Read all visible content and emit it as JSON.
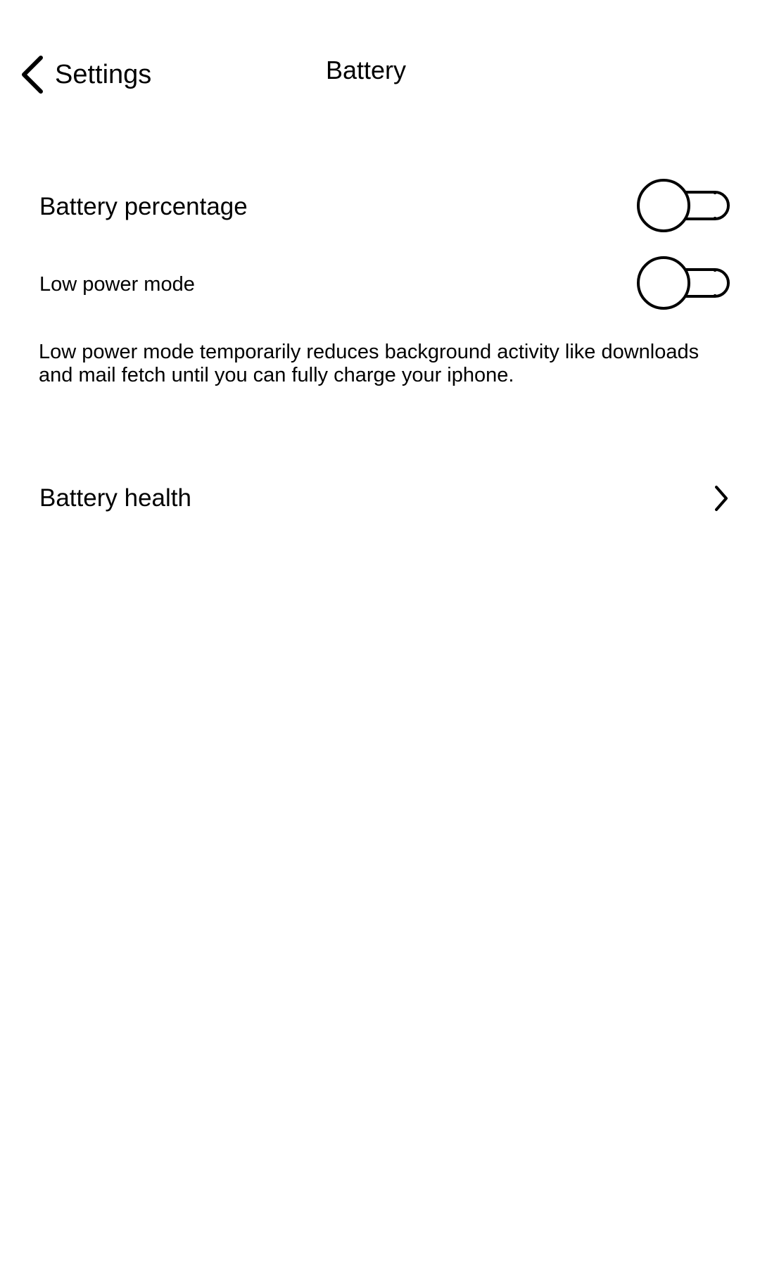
{
  "header": {
    "back_label": "Settings",
    "title": "Battery"
  },
  "settings": {
    "battery_percentage": {
      "label": "Battery percentage",
      "enabled": false
    },
    "low_power_mode": {
      "label": "Low power mode",
      "enabled": false,
      "description": "Low power mode temporarily reduces background activity like downloads and mail fetch until you can fully charge your iphone."
    },
    "battery_health": {
      "label": "Battery health"
    }
  },
  "icons": {
    "back": "chevron-left-icon",
    "health": "chevron-right-icon"
  }
}
